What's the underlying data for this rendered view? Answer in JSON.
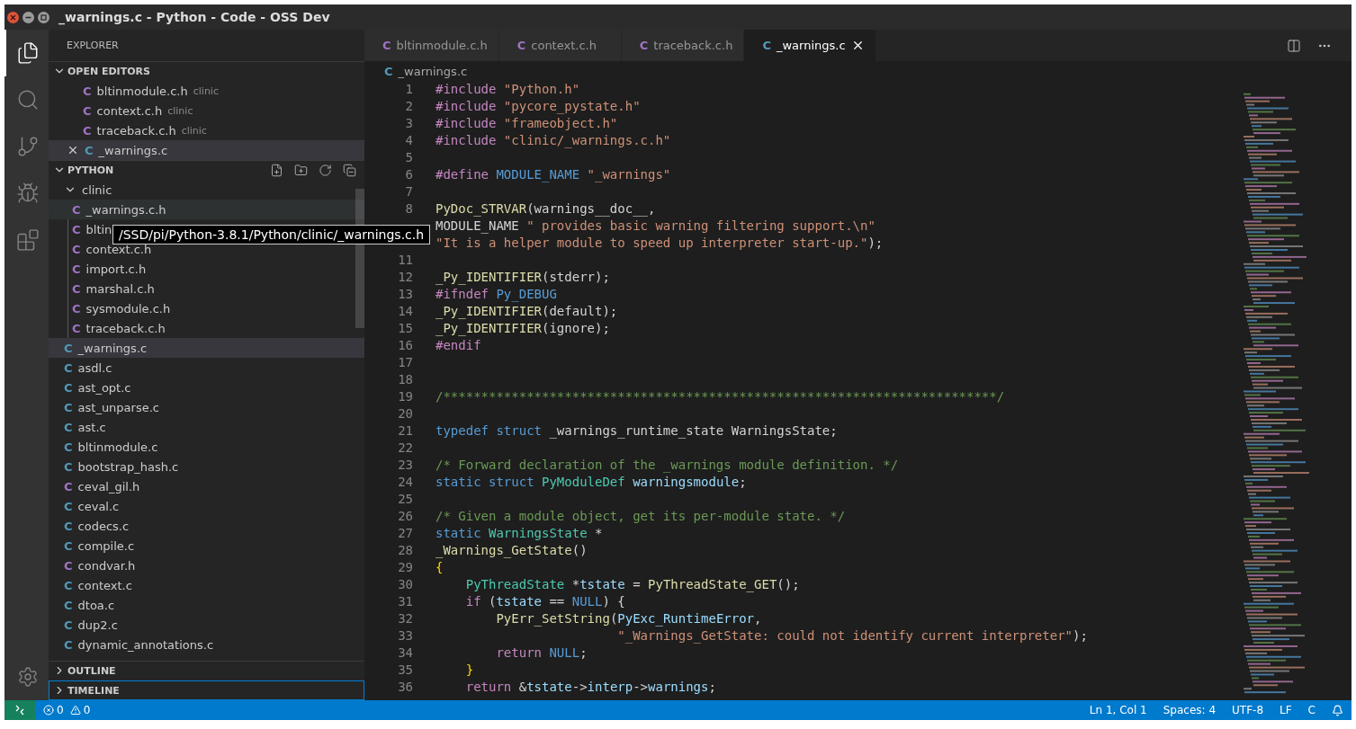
{
  "window": {
    "title": "_warnings.c - Python - Code - OSS Dev"
  },
  "activity_bar": [
    {
      "kind": "files",
      "selected": true
    },
    {
      "kind": "search",
      "selected": false
    },
    {
      "kind": "scm",
      "selected": false
    },
    {
      "kind": "debug",
      "selected": false
    },
    {
      "kind": "extensions",
      "selected": false
    }
  ],
  "sidebar": {
    "title": "EXPLORER",
    "open_editors": {
      "title": "OPEN EDITORS",
      "expanded": true,
      "items": [
        {
          "icon": "C",
          "name": "bltinmodule.c.h",
          "detail": "clinic",
          "color": "#a074c4",
          "selected": false
        },
        {
          "icon": "C",
          "name": "context.c.h",
          "detail": "clinic",
          "color": "#a074c4",
          "selected": false
        },
        {
          "icon": "C",
          "name": "traceback.c.h",
          "detail": "clinic",
          "color": "#a074c4",
          "selected": false
        },
        {
          "icon": "C",
          "name": "_warnings.c",
          "color": "#519aba",
          "selected": true
        }
      ]
    },
    "folder": {
      "title": "PYTHON",
      "expanded": true,
      "items": [
        {
          "name": "clinic",
          "kind": "folder",
          "expanded": true,
          "selected": false,
          "children": [
            {
              "icon": "C",
              "name": "_warnings.c.h",
              "kind": "file",
              "color": "#a074c4",
              "selected": false,
              "hovered": true
            },
            {
              "icon": "C",
              "name": "bltin",
              "kind": "file",
              "color": "#a074c4",
              "selected": false,
              "hovered": false
            },
            {
              "icon": "C",
              "name": "context.c.h",
              "kind": "file",
              "color": "#a074c4",
              "selected": false,
              "hovered": false
            },
            {
              "icon": "C",
              "name": "import.c.h",
              "kind": "file",
              "color": "#a074c4",
              "selected": false,
              "hovered": false
            },
            {
              "icon": "C",
              "name": "marshal.c.h",
              "kind": "file",
              "color": "#a074c4",
              "selected": false,
              "hovered": false
            },
            {
              "icon": "C",
              "name": "sysmodule.c.h",
              "kind": "file",
              "color": "#a074c4",
              "selected": false,
              "hovered": false
            },
            {
              "icon": "C",
              "name": "traceback.c.h",
              "kind": "file",
              "color": "#a074c4",
              "selected": false,
              "hovered": false
            }
          ]
        },
        {
          "icon": "C",
          "name": "_warnings.c",
          "kind": "file",
          "color": "#519aba",
          "selected": true,
          "hovered": false
        },
        {
          "icon": "C",
          "name": "asdl.c",
          "kind": "file",
          "color": "#519aba",
          "selected": false,
          "hovered": false
        },
        {
          "icon": "C",
          "name": "ast_opt.c",
          "kind": "file",
          "color": "#519aba",
          "selected": false,
          "hovered": false
        },
        {
          "icon": "C",
          "name": "ast_unparse.c",
          "kind": "file",
          "color": "#519aba",
          "selected": false,
          "hovered": false
        },
        {
          "icon": "C",
          "name": "ast.c",
          "kind": "file",
          "color": "#519aba",
          "selected": false,
          "hovered": false
        },
        {
          "icon": "C",
          "name": "bltinmodule.c",
          "kind": "file",
          "color": "#519aba",
          "selected": false,
          "hovered": false
        },
        {
          "icon": "C",
          "name": "bootstrap_hash.c",
          "kind": "file",
          "color": "#519aba",
          "selected": false,
          "hovered": false
        },
        {
          "icon": "C",
          "name": "ceval_gil.h",
          "kind": "file",
          "color": "#a074c4",
          "selected": false,
          "hovered": false
        },
        {
          "icon": "C",
          "name": "ceval.c",
          "kind": "file",
          "color": "#519aba",
          "selected": false,
          "hovered": false
        },
        {
          "icon": "C",
          "name": "codecs.c",
          "kind": "file",
          "color": "#519aba",
          "selected": false,
          "hovered": false
        },
        {
          "icon": "C",
          "name": "compile.c",
          "kind": "file",
          "color": "#519aba",
          "selected": false,
          "hovered": false
        },
        {
          "icon": "C",
          "name": "condvar.h",
          "kind": "file",
          "color": "#a074c4",
          "selected": false,
          "hovered": false
        },
        {
          "icon": "C",
          "name": "context.c",
          "kind": "file",
          "color": "#519aba",
          "selected": false,
          "hovered": false
        },
        {
          "icon": "C",
          "name": "dtoa.c",
          "kind": "file",
          "color": "#519aba",
          "selected": false,
          "hovered": false
        },
        {
          "icon": "C",
          "name": "dup2.c",
          "kind": "file",
          "color": "#519aba",
          "selected": false,
          "hovered": false
        },
        {
          "icon": "C",
          "name": "dynamic_annotations.c",
          "kind": "file",
          "color": "#519aba",
          "selected": false,
          "hovered": false
        }
      ]
    },
    "panels": [
      {
        "title": "OUTLINE",
        "expanded": false,
        "focused": false
      },
      {
        "title": "TIMELINE",
        "expanded": false,
        "focused": true
      }
    ]
  },
  "tooltip": {
    "text": "/SSD/pi/Python-3.8.1/Python/clinic/_warnings.c.h"
  },
  "tabs": [
    {
      "icon": "C",
      "label": "bltinmodule.c.h",
      "color": "#a074c4",
      "selected": false
    },
    {
      "icon": "C",
      "label": "context.c.h",
      "color": "#a074c4",
      "selected": false
    },
    {
      "icon": "C",
      "label": "traceback.c.h",
      "color": "#a074c4",
      "selected": false
    },
    {
      "icon": "C",
      "label": "_warnings.c",
      "color": "#519aba",
      "selected": true
    }
  ],
  "breadcrumb": {
    "icon": "C",
    "label": "_warnings.c",
    "color": "#519aba"
  },
  "code": [
    {
      "num": "1",
      "tokens": [
        {
          "kind": "pp",
          "text": "#include "
        },
        {
          "kind": "str",
          "text": "\"Python.h\""
        }
      ]
    },
    {
      "num": "2",
      "tokens": [
        {
          "kind": "pp",
          "text": "#include "
        },
        {
          "kind": "str",
          "text": "\"pycore_pystate.h\""
        }
      ]
    },
    {
      "num": "3",
      "tokens": [
        {
          "kind": "pp",
          "text": "#include "
        },
        {
          "kind": "str",
          "text": "\"frameobject.h\""
        }
      ]
    },
    {
      "num": "4",
      "tokens": [
        {
          "kind": "pp",
          "text": "#include "
        },
        {
          "kind": "str",
          "text": "\"clinic/_warnings.c.h\""
        }
      ]
    },
    {
      "num": "5"
    },
    {
      "num": "6",
      "tokens": [
        {
          "kind": "pp",
          "text": "#define "
        },
        {
          "kind": "kw",
          "text": "MODULE_NAME"
        },
        {
          "kind": "str",
          "text": " \"_warnings\""
        }
      ]
    },
    {
      "num": "7"
    },
    {
      "num": "8",
      "tokens": [
        {
          "kind": "fn",
          "text": "PyDoc_STRVAR"
        },
        {
          "kind": "plain",
          "text": "(warnings__doc__,"
        }
      ]
    },
    {
      "tokens": [
        {
          "kind": "plain",
          "text": "MODULE_NAME "
        },
        {
          "kind": "str",
          "text": "\" provides basic warning filtering support.\\n\""
        }
      ]
    },
    {
      "tokens": [
        {
          "kind": "str",
          "text": "\"It is a helper module to speed up interpreter start-up.\""
        },
        {
          "kind": "plain",
          "text": ");"
        }
      ]
    },
    {
      "num": "11"
    },
    {
      "num": "12",
      "tokens": [
        {
          "kind": "fn",
          "text": "_Py_IDENTIFIER"
        },
        {
          "kind": "plain",
          "text": "(stderr);"
        }
      ]
    },
    {
      "num": "13",
      "tokens": [
        {
          "kind": "pp",
          "text": "#ifndef "
        },
        {
          "kind": "kw",
          "text": "Py_DEBUG"
        }
      ]
    },
    {
      "num": "14",
      "tokens": [
        {
          "kind": "fn",
          "text": "_Py_IDENTIFIER"
        },
        {
          "kind": "plain",
          "text": "(default);"
        }
      ]
    },
    {
      "num": "15",
      "tokens": [
        {
          "kind": "fn",
          "text": "_Py_IDENTIFIER"
        },
        {
          "kind": "plain",
          "text": "(ignore);"
        }
      ]
    },
    {
      "num": "16",
      "tokens": [
        {
          "kind": "pp",
          "text": "#endif"
        }
      ]
    },
    {
      "num": "17"
    },
    {
      "num": "18"
    },
    {
      "num": "19",
      "tokens": [
        {
          "kind": "comment",
          "text": "/*************************************************************************/"
        }
      ]
    },
    {
      "num": "20"
    },
    {
      "num": "21",
      "tokens": [
        {
          "kind": "kw",
          "text": "typedef struct "
        },
        {
          "kind": "plain",
          "text": "_warnings_runtime_state WarningsState;"
        }
      ]
    },
    {
      "num": "22"
    },
    {
      "num": "23",
      "tokens": [
        {
          "kind": "comment",
          "text": "/* Forward declaration of the _warnings module definition. */"
        }
      ]
    },
    {
      "num": "24",
      "tokens": [
        {
          "kind": "kw",
          "text": "static struct "
        },
        {
          "kind": "type",
          "text": "PyModuleDef "
        },
        {
          "kind": "var",
          "text": "warningsmodule"
        },
        {
          "kind": "plain",
          "text": ";"
        }
      ]
    },
    {
      "num": "25"
    },
    {
      "num": "26",
      "tokens": [
        {
          "kind": "comment",
          "text": "/* Given a module object, get its per-module state. */"
        }
      ]
    },
    {
      "num": "27",
      "tokens": [
        {
          "kind": "kw",
          "text": "static "
        },
        {
          "kind": "type",
          "text": "WarningsState "
        },
        {
          "kind": "plain",
          "text": "*"
        }
      ]
    },
    {
      "num": "28",
      "tokens": [
        {
          "kind": "fn",
          "text": "_Warnings_GetState"
        },
        {
          "kind": "plain",
          "text": "()"
        }
      ]
    },
    {
      "num": "29",
      "tokens": [
        {
          "kind": "brace",
          "text": "{"
        }
      ]
    },
    {
      "num": "30",
      "tokens": [
        {
          "kind": "type",
          "text": "    PyThreadState "
        },
        {
          "kind": "plain",
          "text": "*"
        },
        {
          "kind": "var",
          "text": "tstate"
        },
        {
          "kind": "plain",
          "text": " = "
        },
        {
          "kind": "fn",
          "text": "PyThreadState_GET"
        },
        {
          "kind": "plain",
          "text": "();"
        }
      ]
    },
    {
      "num": "31",
      "tokens": [
        {
          "kind": "ctl",
          "text": "    if"
        },
        {
          "kind": "plain",
          "text": " ("
        },
        {
          "kind": "var",
          "text": "tstate"
        },
        {
          "kind": "plain",
          "text": " == "
        },
        {
          "kind": "kw",
          "text": "NULL"
        },
        {
          "kind": "plain",
          "text": ") {"
        }
      ]
    },
    {
      "num": "32",
      "tokens": [
        {
          "kind": "fn",
          "text": "        PyErr_SetString"
        },
        {
          "kind": "plain",
          "text": "("
        },
        {
          "kind": "var",
          "text": "PyExc_RuntimeError"
        },
        {
          "kind": "plain",
          "text": ","
        }
      ]
    },
    {
      "num": "33",
      "tokens": [
        {
          "kind": "str",
          "text": "                        \"_Warnings_GetState: could not identify current interpreter\""
        },
        {
          "kind": "plain",
          "text": ");"
        }
      ]
    },
    {
      "num": "34",
      "tokens": [
        {
          "kind": "ctl",
          "text": "        return "
        },
        {
          "kind": "kw",
          "text": "NULL"
        },
        {
          "kind": "plain",
          "text": ";"
        }
      ]
    },
    {
      "num": "35",
      "tokens": [
        {
          "kind": "brace",
          "text": "    }"
        }
      ]
    },
    {
      "num": "36",
      "tokens": [
        {
          "kind": "ctl",
          "text": "    return "
        },
        {
          "kind": "plain",
          "text": "&"
        },
        {
          "kind": "var",
          "text": "tstate"
        },
        {
          "kind": "plain",
          "text": "->"
        },
        {
          "kind": "var",
          "text": "interp"
        },
        {
          "kind": "plain",
          "text": "->"
        },
        {
          "kind": "var",
          "text": "warnings"
        },
        {
          "kind": "plain",
          "text": ";"
        }
      ]
    }
  ],
  "status_bar": {
    "errors": "0",
    "warnings": "0",
    "items": [
      "Ln 1, Col 1",
      "Spaces: 4",
      "UTF-8",
      "LF",
      "C"
    ]
  }
}
